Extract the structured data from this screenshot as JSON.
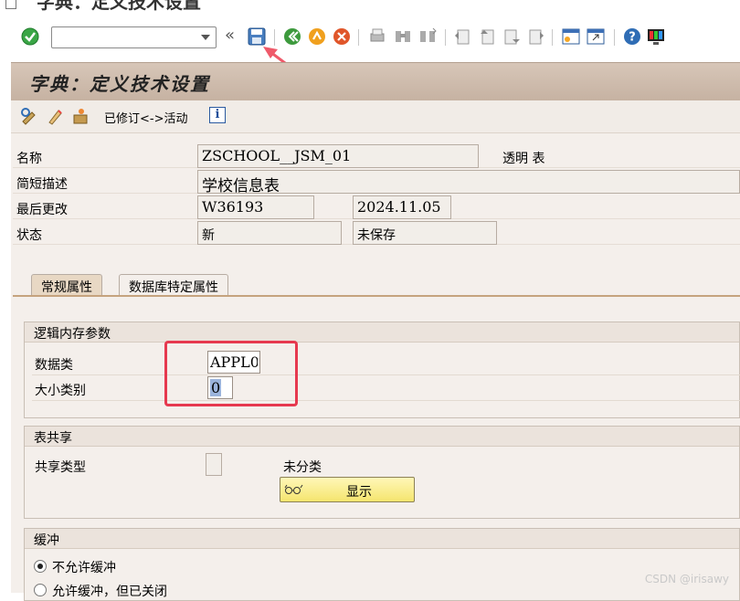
{
  "window": {
    "title": "字典：定义技术设置"
  },
  "toolbar": {
    "command_value": ""
  },
  "header": {
    "title": "字典：定义技术设置"
  },
  "app_toolbar": {
    "activate_label": "已修订<->活动"
  },
  "fields": {
    "name": {
      "label": "名称",
      "value": "ZSCHOOL__JSM_01",
      "side_text": "透明 表"
    },
    "short_desc": {
      "label": "简短描述",
      "value": "学校信息表"
    },
    "last_changed": {
      "label": "最后更改",
      "user": "W36193",
      "date": "2024.11.05"
    },
    "status": {
      "label": "状态",
      "value1": "新",
      "value2": "未保存"
    }
  },
  "tabs": [
    {
      "label": "常规属性",
      "active": true
    },
    {
      "label": "数据库特定属性",
      "active": false
    }
  ],
  "logical_storage": {
    "title": "逻辑内存参数",
    "data_class_label": "数据类",
    "data_class_value": "APPL0",
    "size_category_label": "大小类别",
    "size_category_value": "0"
  },
  "table_sharing": {
    "title": "表共享",
    "sharing_type_label": "共享类型",
    "unclassified_text": "未分类",
    "show_button": "显示"
  },
  "buffering": {
    "title": "缓冲",
    "options": [
      {
        "label": "不允许缓冲",
        "checked": true
      },
      {
        "label": "允许缓冲，但已关闭",
        "checked": false
      }
    ]
  },
  "watermark": "CSDN @irisawy",
  "colors": {
    "header_bar": "#c6b2a2",
    "panel": "#f4efeb",
    "annotation_red": "#e6394f",
    "show_button": "#f5e56e"
  }
}
